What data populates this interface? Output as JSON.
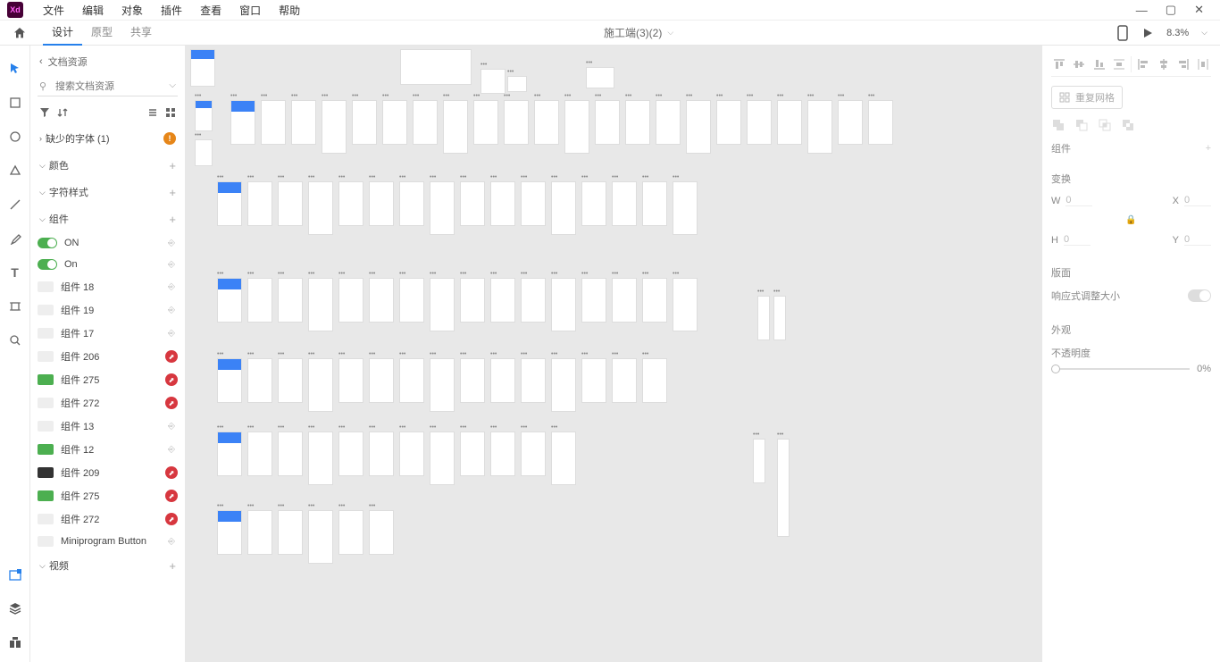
{
  "menubar": {
    "items": [
      "文件",
      "编辑",
      "对象",
      "插件",
      "查看",
      "窗口",
      "帮助"
    ]
  },
  "tabs": {
    "design": "设计",
    "prototype": "原型",
    "share": "共享"
  },
  "document_title": "施工端(3)(2)",
  "zoom": "8.3%",
  "left": {
    "breadcrumb": "文档资源",
    "search_placeholder": "搜索文档资源",
    "missing_fonts": "缺少的字体 (1)",
    "sections": {
      "color": "颜色",
      "charstyle": "字符样式",
      "components": "组件",
      "video": "视频"
    },
    "components": [
      {
        "label": "ON",
        "kind": "toggle",
        "badge": "gray"
      },
      {
        "label": "On",
        "kind": "toggle",
        "badge": "gray"
      },
      {
        "label": "组件 18",
        "kind": "thumb",
        "badge": "gray"
      },
      {
        "label": "组件 19",
        "kind": "thumb",
        "badge": "gray"
      },
      {
        "label": "组件 17",
        "kind": "thumb",
        "badge": "gray"
      },
      {
        "label": "组件 206",
        "kind": "thumb",
        "badge": "red"
      },
      {
        "label": "组件 275",
        "kind": "green",
        "badge": "red"
      },
      {
        "label": "组件 272",
        "kind": "thumb",
        "badge": "red"
      },
      {
        "label": "组件 13",
        "kind": "thumb",
        "badge": "gray"
      },
      {
        "label": "组件 12",
        "kind": "green",
        "badge": "gray"
      },
      {
        "label": "组件 209",
        "kind": "dark",
        "badge": "red"
      },
      {
        "label": "组件 275",
        "kind": "green",
        "badge": "red"
      },
      {
        "label": "组件 272",
        "kind": "thumb",
        "badge": "red"
      },
      {
        "label": "Miniprogram Button",
        "kind": "thumb",
        "badge": "gray"
      }
    ]
  },
  "right": {
    "repeat_grid": "重复网格",
    "components_label": "组件",
    "transform_label": "变换",
    "w": "0",
    "h": "0",
    "x": "0",
    "y": "0",
    "layout_label": "版面",
    "responsive": "响应式调整大小",
    "appearance_label": "外观",
    "opacity_label": "不透明度",
    "opacity_value": "0%"
  }
}
